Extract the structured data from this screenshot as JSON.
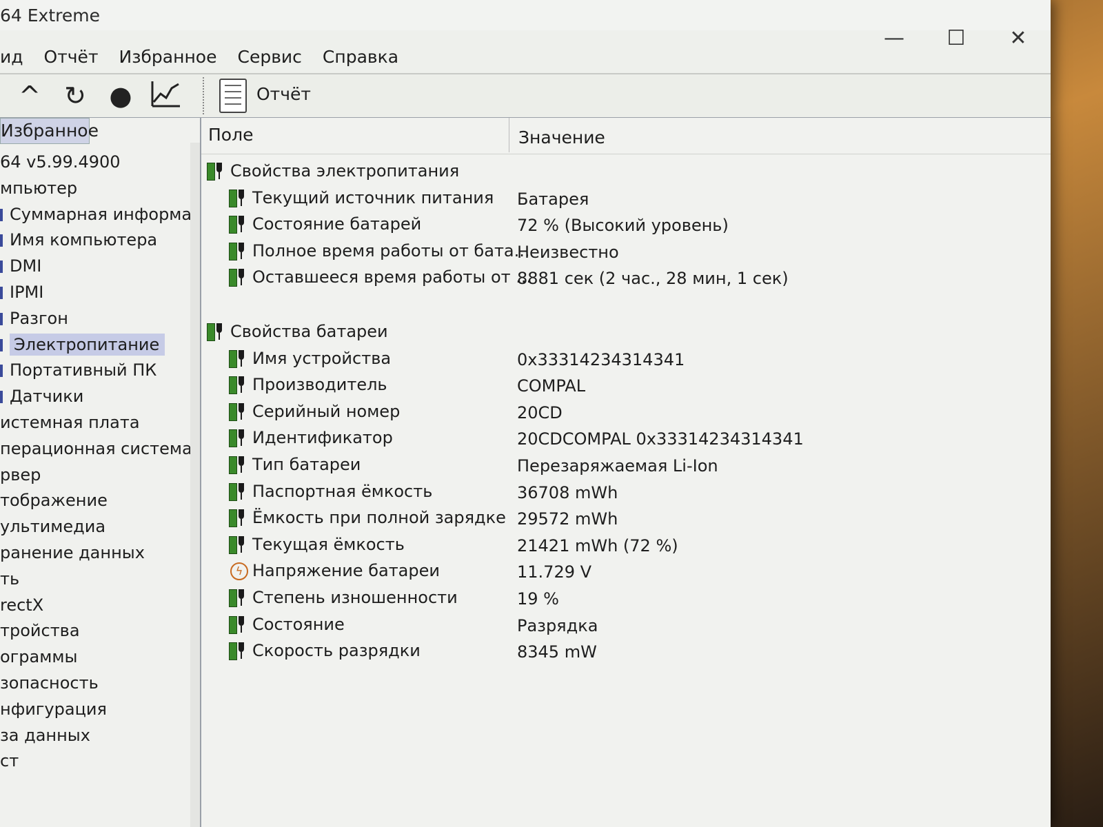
{
  "window": {
    "title": "64 Extreme",
    "minimize": "—",
    "maximize": "☐",
    "close": "✕"
  },
  "menu": [
    "ид",
    "Отчёт",
    "Избранное",
    "Сервис",
    "Справка"
  ],
  "toolbar": {
    "up_icon": "caret-up-icon",
    "refresh_icon": "refresh-icon",
    "user_icon": "user-icon",
    "chart_icon": "chart-icon",
    "report_label": "Отчёт"
  },
  "sidebar": {
    "tab_label": "Избранное",
    "items": [
      {
        "label": "64 v5.99.4900",
        "level": 1
      },
      {
        "label": "мпьютер",
        "level": 1
      },
      {
        "label": "Суммарная информац",
        "level": 2
      },
      {
        "label": "Имя компьютера",
        "level": 2
      },
      {
        "label": "DMI",
        "level": 2
      },
      {
        "label": "IPMI",
        "level": 2
      },
      {
        "label": "Разгон",
        "level": 2
      },
      {
        "label": "Электропитание",
        "level": 2,
        "selected": true
      },
      {
        "label": "Портативный ПК",
        "level": 2
      },
      {
        "label": "Датчики",
        "level": 2
      },
      {
        "label": "истемная плата",
        "level": 1
      },
      {
        "label": "перационная система",
        "level": 1
      },
      {
        "label": "рвер",
        "level": 1
      },
      {
        "label": "тображение",
        "level": 1
      },
      {
        "label": "ультимедиа",
        "level": 1
      },
      {
        "label": "ранение данных",
        "level": 1
      },
      {
        "label": "ть",
        "level": 1
      },
      {
        "label": "rectX",
        "level": 1
      },
      {
        "label": "тройства",
        "level": 1
      },
      {
        "label": "ограммы",
        "level": 1
      },
      {
        "label": "зопасность",
        "level": 1
      },
      {
        "label": "нфигурация",
        "level": 1
      },
      {
        "label": "за данных",
        "level": 1
      },
      {
        "label": "ст",
        "level": 1
      }
    ]
  },
  "table": {
    "col_field": "Поле",
    "col_value": "Значение",
    "rows": [
      {
        "kind": "group",
        "field": "Свойства электропитания",
        "value": "",
        "icon": "battery-plug-icon"
      },
      {
        "kind": "item",
        "field": "Текущий источник питания",
        "value": "Батарея",
        "icon": "battery-plug-icon"
      },
      {
        "kind": "item",
        "field": "Состояние батарей",
        "value": "72 % (Высокий уровень)",
        "icon": "battery-plug-icon"
      },
      {
        "kind": "item",
        "field": "Полное время работы от бата...",
        "value": "Неизвестно",
        "icon": "battery-plug-icon"
      },
      {
        "kind": "item",
        "field": "Оставшееся время работы от ...",
        "value": "8881 сек (2 час., 28 мин, 1 сек)",
        "icon": "battery-plug-icon"
      },
      {
        "kind": "gap",
        "field": "",
        "value": "",
        "icon": ""
      },
      {
        "kind": "group",
        "field": "Свойства батареи",
        "value": "",
        "icon": "battery-plug-icon"
      },
      {
        "kind": "item",
        "field": "Имя устройства",
        "value": "0x33314234314341",
        "icon": "battery-plug-icon"
      },
      {
        "kind": "item",
        "field": "Производитель",
        "value": "COMPAL",
        "icon": "battery-plug-icon"
      },
      {
        "kind": "item",
        "field": "Серийный номер",
        "value": "20CD",
        "icon": "battery-plug-icon"
      },
      {
        "kind": "item",
        "field": "Идентификатор",
        "value": "20CDCOMPAL 0x33314234314341",
        "icon": "battery-plug-icon"
      },
      {
        "kind": "item",
        "field": "Тип батареи",
        "value": "Перезаряжаемая Li-Ion",
        "icon": "battery-plug-icon"
      },
      {
        "kind": "item",
        "field": "Паспортная ёмкость",
        "value": "36708 mWh",
        "icon": "battery-plug-icon"
      },
      {
        "kind": "item",
        "field": "Ёмкость при полной зарядке",
        "value": "29572 mWh",
        "icon": "battery-plug-icon"
      },
      {
        "kind": "item",
        "field": "Текущая ёмкость",
        "value": "21421 mWh  (72 %)",
        "icon": "battery-plug-icon"
      },
      {
        "kind": "item",
        "field": "Напряжение батареи",
        "value": "11.729 V",
        "icon": "voltage-icon"
      },
      {
        "kind": "item",
        "field": "Степень изношенности",
        "value": "19 %",
        "icon": "battery-plug-icon"
      },
      {
        "kind": "item",
        "field": "Состояние",
        "value": "Разрядка",
        "icon": "battery-plug-icon"
      },
      {
        "kind": "item",
        "field": "Скорость разрядки",
        "value": "8345 mW",
        "icon": "battery-plug-icon"
      }
    ]
  },
  "colors": {
    "battery_green": "#3a8a2a",
    "selection": "#c6cbe6",
    "voltage_orange": "#c86a20"
  }
}
